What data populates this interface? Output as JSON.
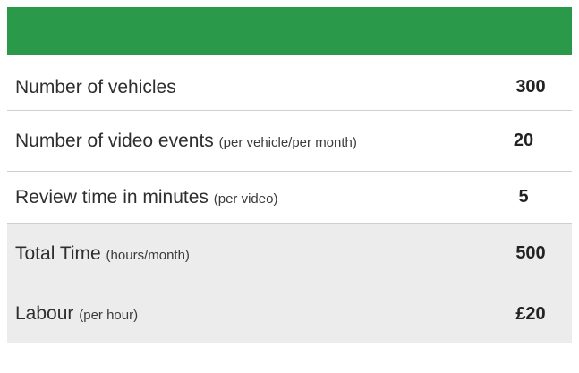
{
  "colors": {
    "header": "#2a9a4a",
    "shaded_row": "#ececec",
    "divider": "#cfcfcf"
  },
  "rows": [
    {
      "label": "Number of vehicles",
      "note": "",
      "value": "300",
      "shaded": false
    },
    {
      "label": "Number of video events",
      "note": "(per vehicle/per month)",
      "value": "20",
      "shaded": false
    },
    {
      "label": "Review time in minutes",
      "note": "(per video)",
      "value": "5",
      "shaded": false
    },
    {
      "label": "Total Time",
      "note": "(hours/month)",
      "value": "500",
      "shaded": true
    },
    {
      "label": "Labour",
      "note": "(per hour)",
      "value": "£20",
      "shaded": true
    }
  ]
}
